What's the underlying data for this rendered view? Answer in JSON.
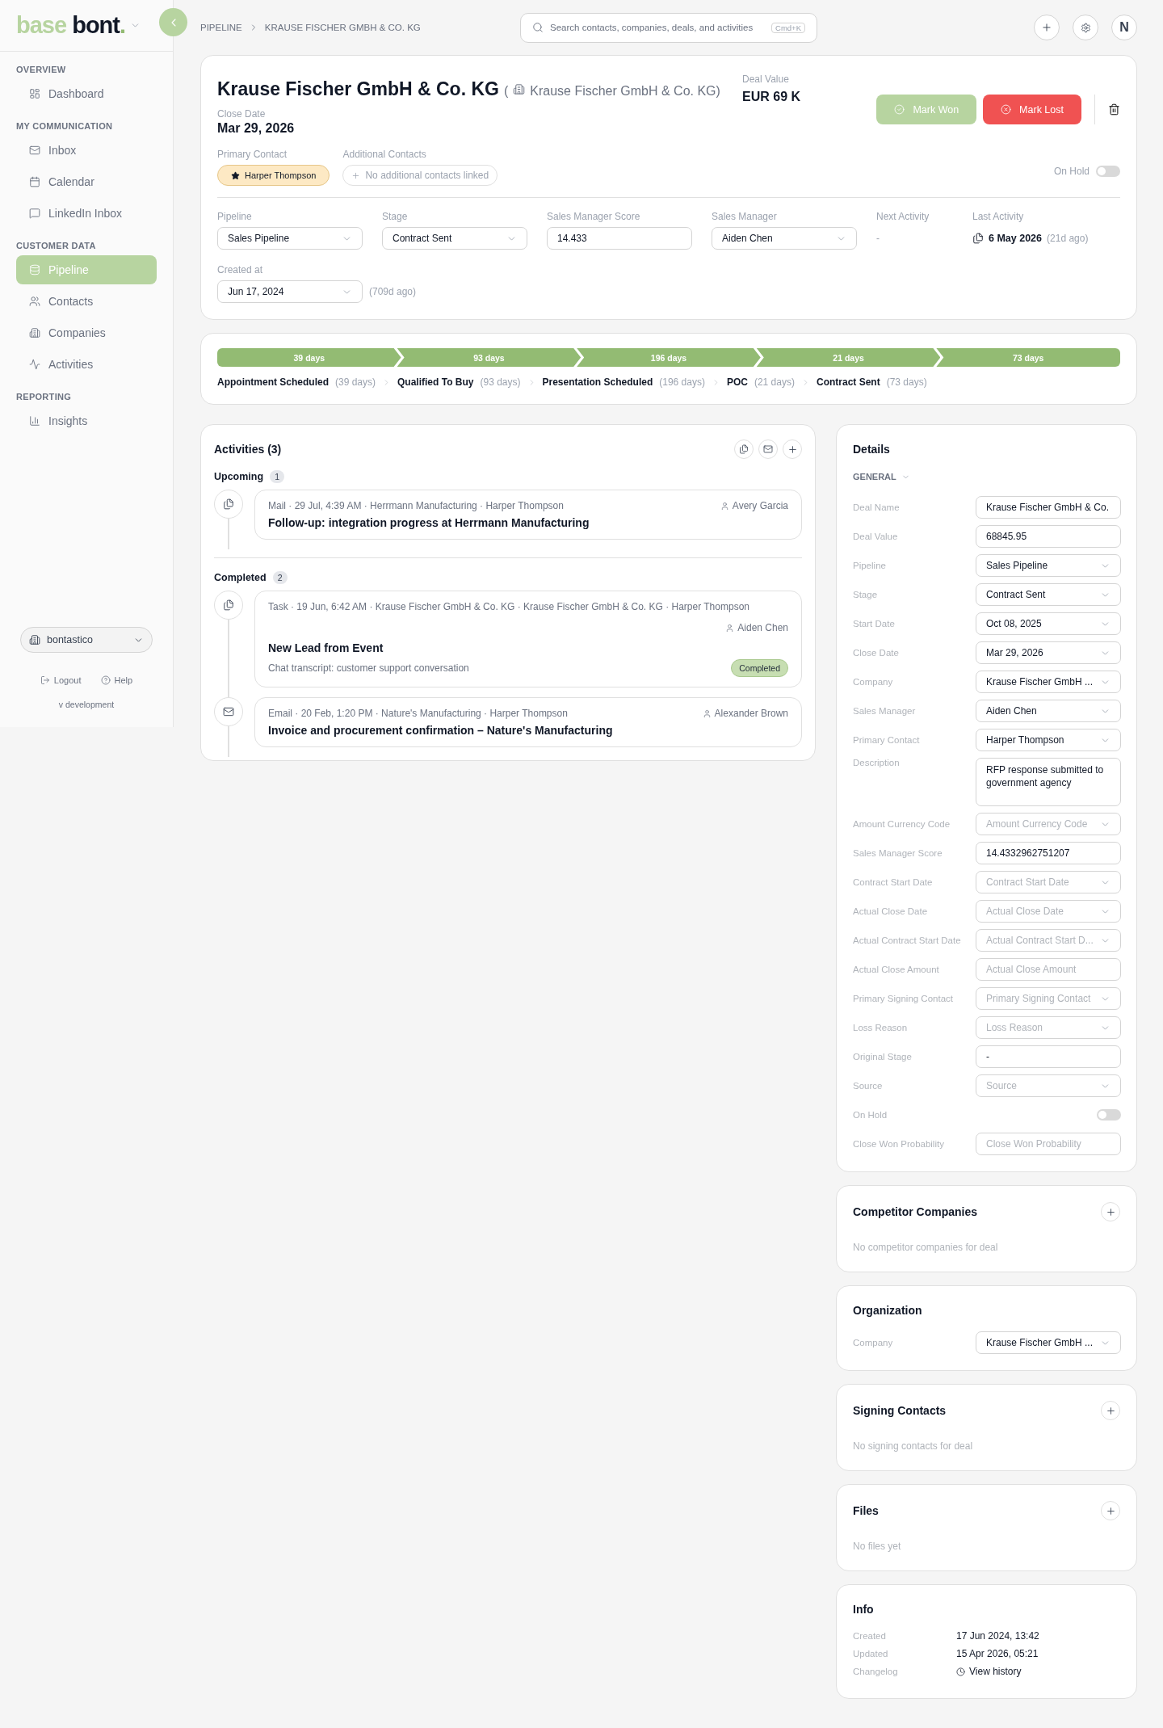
{
  "sidebar": {
    "logo": {
      "light": "base",
      "dark": "bont",
      "dot": "."
    },
    "sections": [
      {
        "title": "OVERVIEW",
        "items": [
          {
            "label": "Dashboard",
            "selected": false
          }
        ]
      },
      {
        "title": "MY COMMUNICATION",
        "items": [
          {
            "label": "Inbox",
            "selected": false
          },
          {
            "label": "Calendar",
            "selected": false
          },
          {
            "label": "LinkedIn Inbox",
            "selected": false
          }
        ]
      },
      {
        "title": "CUSTOMER DATA",
        "items": [
          {
            "label": "Pipeline",
            "selected": true
          },
          {
            "label": "Contacts",
            "selected": false
          },
          {
            "label": "Companies",
            "selected": false
          },
          {
            "label": "Activities",
            "selected": false
          }
        ]
      },
      {
        "title": "REPORTING",
        "items": [
          {
            "label": "Insights",
            "selected": false
          }
        ]
      }
    ],
    "workspace": "bontastico",
    "logout": "Logout",
    "help": "Help",
    "version": "v development"
  },
  "topbar": {
    "breadcrumbs": [
      "PIPELINE",
      "KRAUSE FISCHER GMBH & CO. KG"
    ],
    "search": {
      "placeholder": "Search contacts, companies, deals, and activities",
      "shortcut": "Cmd+K"
    },
    "avatar": "N"
  },
  "deal": {
    "title": "Krause Fischer GmbH & Co. KG",
    "paren_open": "(",
    "company": "Krause Fischer GmbH & Co. KG",
    "paren_close": ")",
    "close_date_label": "Close Date",
    "close_date": "Mar 29, 2026",
    "deal_value_label": "Deal Value",
    "deal_value": "EUR 69 K",
    "mark_won": "Mark Won",
    "mark_lost": "Mark Lost",
    "primary_contact_label": "Primary Contact",
    "primary_contact": "Harper Thompson",
    "additional_contacts_label": "Additional Contacts",
    "additional_contacts_placeholder": "No additional contacts linked",
    "on_hold_label": "On Hold",
    "on_hold": false,
    "fields": [
      {
        "kind": "select",
        "label": "Pipeline",
        "value": "Sales Pipeline"
      },
      {
        "kind": "select",
        "label": "Stage",
        "value": "Contract Sent"
      },
      {
        "kind": "input",
        "label": "Sales Manager Score",
        "value": "14.433"
      },
      {
        "kind": "select",
        "label": "Sales Manager",
        "value": "Aiden Chen"
      },
      {
        "kind": "text",
        "label": "Next Activity",
        "value": "-"
      },
      {
        "kind": "activity",
        "label": "Last Activity",
        "value": "6 May 2026",
        "ago": "(21d ago)"
      }
    ],
    "created": {
      "label": "Created at",
      "value": "Jun 17, 2024",
      "ago": "(709d ago)"
    }
  },
  "stages": [
    {
      "days": "39 days",
      "name": "Appointment Scheduled",
      "duration": "(39 days)"
    },
    {
      "days": "93 days",
      "name": "Qualified To Buy",
      "duration": "(93 days)"
    },
    {
      "days": "196 days",
      "name": "Presentation Scheduled",
      "duration": "(196 days)"
    },
    {
      "days": "21 days",
      "name": "POC",
      "duration": "(21 days)"
    },
    {
      "days": "73 days",
      "name": "Contract Sent",
      "duration": "(73 days)"
    }
  ],
  "activities": {
    "title": "Activities (3)",
    "groups": [
      {
        "title": "Upcoming",
        "count": "1",
        "items": [
          {
            "kind": "task",
            "meta": "Mail · 29 Jul, 4:39 AM · Herrmann Manufacturing · Harper Thompson",
            "owner": "Avery Garcia",
            "title": "Follow-up: integration progress at Herrmann Manufacturing"
          }
        ]
      },
      {
        "title": "Completed",
        "count": "2",
        "items": [
          {
            "kind": "task",
            "meta": "Task · 19 Jun, 6:42 AM · Krause Fischer GmbH & Co. KG · Krause Fischer GmbH & Co. KG · Harper Thompson",
            "owner": "Aiden Chen",
            "title": "New Lead from Event",
            "description": "Chat transcript: customer support conversation",
            "status": "Completed"
          },
          {
            "kind": "email",
            "meta": "Email · 20 Feb, 1:20 PM · Nature's Manufacturing · Harper Thompson",
            "owner": "Alexander Brown",
            "title": "Invoice and procurement confirmation – Nature's Manufacturing"
          }
        ]
      }
    ]
  },
  "details": {
    "title": "Details",
    "section": "GENERAL",
    "fields": [
      {
        "kind": "input",
        "label": "Deal Name",
        "value": "Krause Fischer GmbH & Co."
      },
      {
        "kind": "input",
        "label": "Deal Value",
        "value": "68845.95"
      },
      {
        "kind": "select",
        "label": "Pipeline",
        "value": "Sales Pipeline"
      },
      {
        "kind": "select",
        "label": "Stage",
        "value": "Contract Sent"
      },
      {
        "kind": "select",
        "label": "Start Date",
        "value": "Oct 08, 2025"
      },
      {
        "kind": "select",
        "label": "Close Date",
        "value": "Mar 29, 2026"
      },
      {
        "kind": "select",
        "label": "Company",
        "value": "Krause Fischer GmbH ..."
      },
      {
        "kind": "select",
        "label": "Sales Manager",
        "value": "Aiden Chen"
      },
      {
        "kind": "select",
        "label": "Primary Contact",
        "value": "Harper Thompson"
      },
      {
        "kind": "textarea",
        "label": "Description",
        "value": "RFP response submitted to government agency"
      },
      {
        "kind": "select",
        "label": "Amount Currency Code",
        "placeholder": "Amount Currency Code"
      },
      {
        "kind": "input",
        "label": "Sales Manager Score",
        "value": "14.4332962751207"
      },
      {
        "kind": "select",
        "label": "Contract Start Date",
        "placeholder": "Contract Start Date"
      },
      {
        "kind": "select",
        "label": "Actual Close Date",
        "placeholder": "Actual Close Date"
      },
      {
        "kind": "select",
        "label": "Actual Contract Start Date",
        "placeholder": "Actual Contract Start D..."
      },
      {
        "kind": "input",
        "label": "Actual Close Amount",
        "placeholder": "Actual Close Amount"
      },
      {
        "kind": "select",
        "label": "Primary Signing Contact",
        "placeholder": "Primary Signing Contact"
      },
      {
        "kind": "select",
        "label": "Loss Reason",
        "placeholder": "Loss Reason"
      },
      {
        "kind": "input",
        "label": "Original Stage",
        "value": "-"
      },
      {
        "kind": "select",
        "label": "Source",
        "placeholder": "Source"
      },
      {
        "kind": "toggle",
        "label": "On Hold",
        "on": false
      },
      {
        "kind": "input",
        "label": "Close Won Probability",
        "placeholder": "Close Won Probability"
      }
    ]
  },
  "competitors": {
    "title": "Competitor Companies",
    "empty": "No competitor companies for deal"
  },
  "organization": {
    "title": "Organization",
    "label": "Company",
    "value": "Krause Fischer GmbH ..."
  },
  "signing_contacts": {
    "title": "Signing Contacts",
    "empty": "No signing contacts for deal"
  },
  "files": {
    "title": "Files",
    "empty": "No files yet"
  },
  "info": {
    "title": "Info",
    "rows": [
      {
        "kind": "text",
        "label": "Created",
        "value": "17 Jun 2024, 13:42"
      },
      {
        "kind": "text",
        "label": "Updated",
        "value": "15 Apr 2026, 05:21"
      },
      {
        "kind": "link",
        "label": "Changelog",
        "value": "View history"
      }
    ]
  }
}
